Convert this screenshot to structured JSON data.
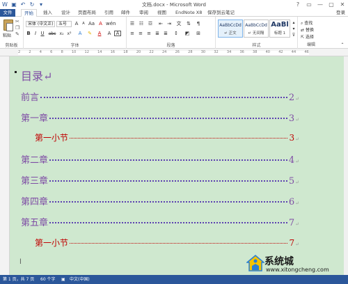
{
  "window": {
    "title": "文档.docx - Microsoft Word",
    "controls": [
      "?",
      "▭",
      "—",
      "▢",
      "✕"
    ]
  },
  "tabs": {
    "file": "文件",
    "items": [
      "开始",
      "插入",
      "设计",
      "页面布局",
      "引用",
      "邮件",
      "审阅",
      "视图",
      "EndNote X8",
      "保存到云笔记"
    ],
    "login": "登录"
  },
  "ribbon": {
    "clipboard": {
      "paste": "粘贴",
      "label": "剪贴板"
    },
    "font": {
      "name": "宋体 (中文正)",
      "size": "五号",
      "label": "字体",
      "bold": "B",
      "italic": "I",
      "underline": "U",
      "strike": "abc",
      "sub": "x₂",
      "sup": "x²",
      "grow": "A",
      "shrink": "A",
      "clear": "A",
      "color_a": "A"
    },
    "paragraph": {
      "label": "段落"
    },
    "styles": {
      "label": "样式",
      "cards": [
        {
          "preview": "AaBbCcDd",
          "name": "↵ 正文"
        },
        {
          "preview": "AaBbCcDd",
          "name": "↵ 无间隔"
        },
        {
          "preview": "AaBl",
          "name": "标题 1"
        }
      ]
    },
    "editing": {
      "label": "编辑",
      "find": "查找",
      "replace": "替换",
      "select": "选择"
    }
  },
  "ruler": {
    "numbers": [
      "2",
      "",
      "2",
      "4",
      "6",
      "8",
      "10",
      "12",
      "14",
      "16",
      "18",
      "20",
      "22",
      "24",
      "26",
      "28",
      "30",
      "32",
      "34",
      "36",
      "38",
      "40",
      "42",
      "44",
      "46"
    ]
  },
  "document": {
    "toc_title": "目录",
    "entries": [
      {
        "label": "前言",
        "page": "2",
        "level": 1
      },
      {
        "label": "第一章",
        "page": "3",
        "level": 1
      },
      {
        "label": "第一小节",
        "page": "3",
        "level": 2
      },
      {
        "label": "第二章",
        "page": "4",
        "level": 1
      },
      {
        "label": "第三章",
        "page": "5",
        "level": 1
      },
      {
        "label": "第四章",
        "page": "6",
        "level": 1
      },
      {
        "label": "第五章",
        "page": "7",
        "level": 1
      },
      {
        "label": "第一小节",
        "page": "7",
        "level": 2
      }
    ],
    "para_mark": "↵"
  },
  "status": {
    "page": "第 1 页，共 7 页",
    "words": "60 个字",
    "lang": "中文(中国)"
  },
  "watermark": {
    "name": "系统城",
    "url": "www.xitongcheng.com"
  },
  "colors": {
    "accent": "#2b579a",
    "page_bg": "#cfe8cf",
    "heading": "#7f4da5",
    "subheading": "#c00000"
  }
}
